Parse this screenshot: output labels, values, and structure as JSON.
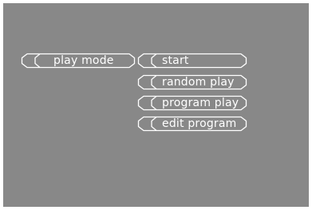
{
  "menu": {
    "root": {
      "label": "play mode"
    },
    "items": [
      {
        "label": "start"
      },
      {
        "label": "random play"
      },
      {
        "label": "program play"
      },
      {
        "label": "edit program"
      }
    ]
  },
  "colors": {
    "background": "#888888",
    "outline": "#ffffff",
    "text": "#ffffff"
  }
}
